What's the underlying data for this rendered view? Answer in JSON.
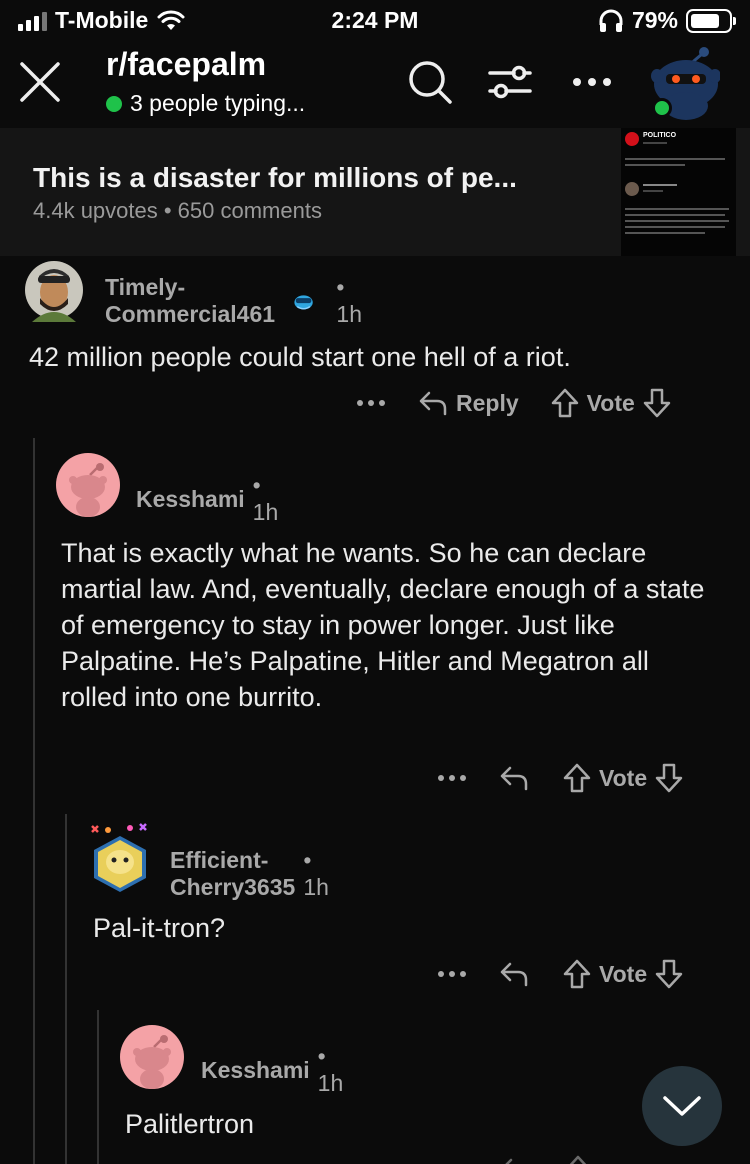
{
  "status": {
    "carrier": "T-Mobile",
    "time": "2:24 PM",
    "battery": "79%",
    "battery_level": 0.79
  },
  "header": {
    "subreddit": "r/facepalm",
    "typing": "3 people typing..."
  },
  "post": {
    "title": "This is a disaster for millions of pe...",
    "meta": "4.4k upvotes • 650 comments",
    "thumbnail_source": "POLITICO"
  },
  "comments": [
    {
      "user": "Timely-Commercial461",
      "time": "• 1h",
      "body": "42 million people could start one hell of a riot.",
      "reply_label": "Reply",
      "vote_label": "Vote"
    },
    {
      "user": "Kesshami",
      "time": "• 1h",
      "body": "That is exactly what he wants. So he can declare martial law. And, eventually, declare enough of a state of emergency to stay in power longer. Just like Palpatine. He’s Palpatine, Hitler and Megatron all rolled into one burrito.",
      "vote_label": "Vote"
    },
    {
      "user": "Efficient-Cherry3635",
      "time": "• 1h",
      "body": "Pal-it-tron?",
      "vote_label": "Vote"
    },
    {
      "user": "Kesshami",
      "time": "• 1h",
      "body": "Palitlertron"
    }
  ],
  "colors": {
    "background": "#0b0b0b",
    "online": "#1fc24a",
    "snoo_pink": "#f4a2a6"
  }
}
